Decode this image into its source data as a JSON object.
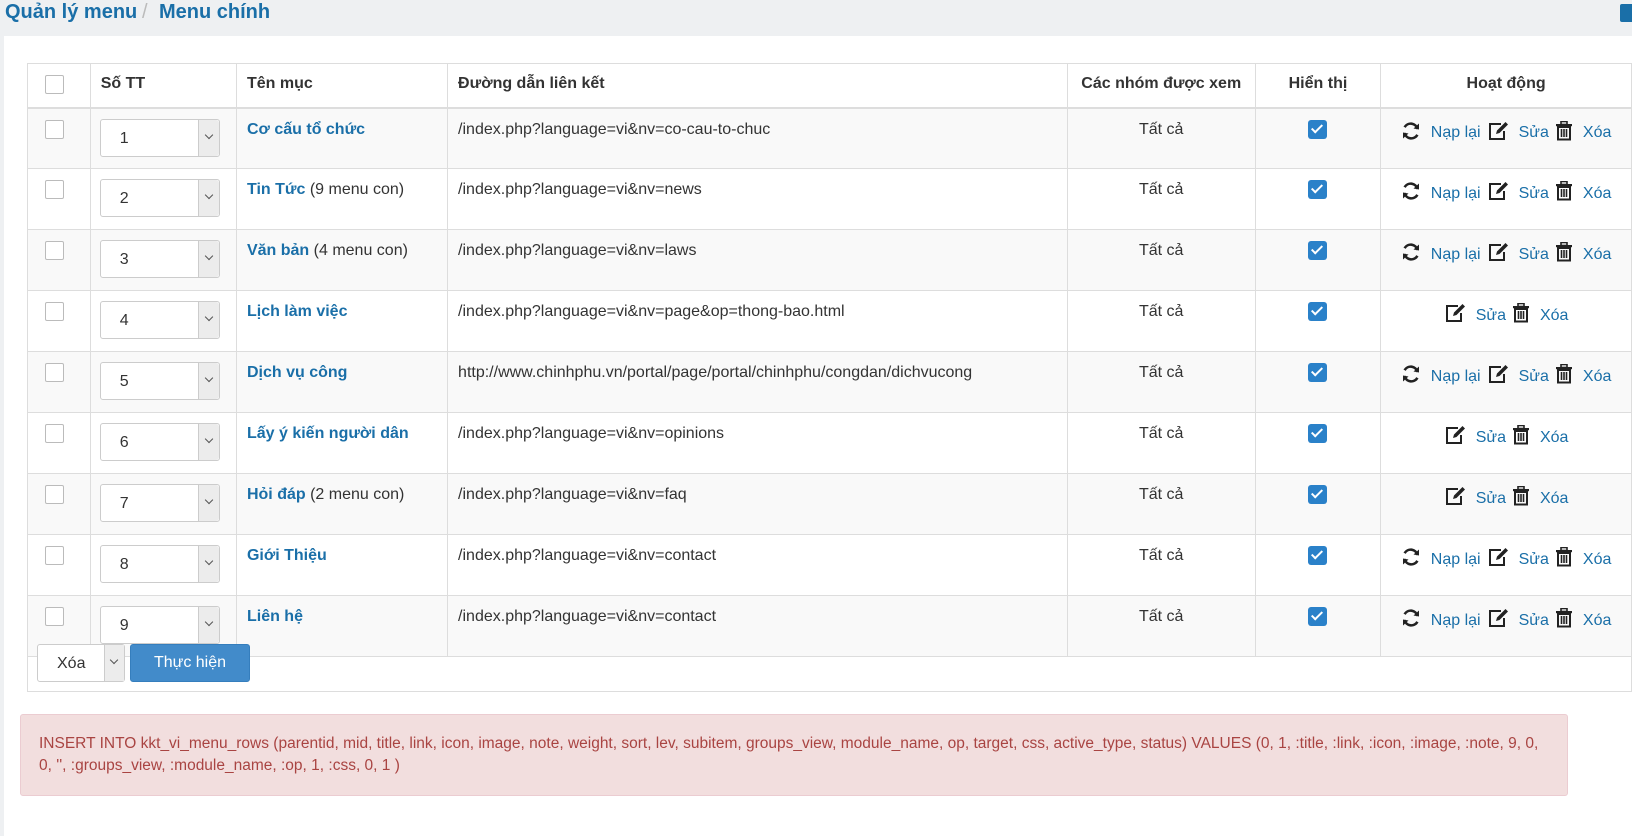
{
  "breadcrumb": {
    "item1": "Quản lý menu",
    "separator": "/",
    "item2": "Menu chính"
  },
  "table": {
    "headers": {
      "order": "Số TT",
      "title": "Tên mục",
      "link": "Đường dẫn liên kết",
      "groups": "Các nhóm được xem",
      "show": "Hiển thị",
      "actions": "Hoạt động"
    },
    "rows": [
      {
        "order": "1",
        "title": "Cơ cấu tổ chức",
        "sub": "",
        "link": "/index.php?language=vi&nv=co-cau-to-chuc",
        "groups": "Tất cả",
        "reload": "Nạp lại",
        "edit": "Sửa",
        "delete": "Xóa"
      },
      {
        "order": "2",
        "title": "Tin Tức",
        "sub": " (9 menu con)",
        "link": "/index.php?language=vi&nv=news",
        "groups": "Tất cả",
        "reload": "Nạp lại",
        "edit": "Sửa",
        "delete": "Xóa"
      },
      {
        "order": "3",
        "title": "Văn bản",
        "sub": " (4 menu con)",
        "link": "/index.php?language=vi&nv=laws",
        "groups": "Tất cả",
        "reload": "Nạp lại",
        "edit": "Sửa",
        "delete": "Xóa"
      },
      {
        "order": "4",
        "title": "Lịch làm việc",
        "sub": "",
        "link": "/index.php?language=vi&nv=page&op=thong-bao.html",
        "groups": "Tất cả",
        "reload": "",
        "edit": "Sửa",
        "delete": "Xóa"
      },
      {
        "order": "5",
        "title": "Dịch vụ công",
        "sub": "",
        "link": "http://www.chinhphu.vn/portal/page/portal/chinhphu/congdan/dichvucong",
        "groups": "Tất cả",
        "reload": "Nạp lại",
        "edit": "Sửa",
        "delete": "Xóa"
      },
      {
        "order": "6",
        "title": "Lấy ý kiến người dân",
        "sub": "",
        "link": "/index.php?language=vi&nv=opinions",
        "groups": "Tất cả",
        "reload": "",
        "edit": "Sửa",
        "delete": "Xóa"
      },
      {
        "order": "7",
        "title": "Hỏi đáp",
        "sub": " (2 menu con)",
        "link": "/index.php?language=vi&nv=faq",
        "groups": "Tất cả",
        "reload": "",
        "edit": "Sửa",
        "delete": "Xóa"
      },
      {
        "order": "8",
        "title": "Giới Thiệu",
        "sub": "",
        "link": "/index.php?language=vi&nv=contact",
        "groups": "Tất cả",
        "reload": "Nạp lại",
        "edit": "Sửa",
        "delete": "Xóa"
      },
      {
        "order": "9",
        "title": "Liên hệ",
        "sub": "",
        "link": "/index.php?language=vi&nv=contact",
        "groups": "Tất cả",
        "reload": "Nạp lại",
        "edit": "Sửa",
        "delete": "Xóa"
      }
    ]
  },
  "bulk": {
    "selected": "Xóa",
    "submit": "Thực hiện"
  },
  "error": {
    "message": "INSERT INTO kkt_vi_menu_rows (parentid, mid, title, link, icon, image, note, weight, sort, lev, subitem, groups_view, module_name, op, target, css, active_type, status) VALUES (0, 1, :title, :link, :icon, :image, :note, 9, 0, 0, '', :groups_view, :module_name, :op, 1, :css, 0, 1 )"
  },
  "colors": {
    "accent": "#1a6fa8",
    "button": "#428bca",
    "check": "#2a81c9",
    "alert_bg": "#f2dede",
    "alert_text": "#a94442"
  },
  "icons": {
    "reload": "refresh-icon",
    "edit": "edit-icon",
    "delete": "trash-icon",
    "check": "check-icon"
  }
}
